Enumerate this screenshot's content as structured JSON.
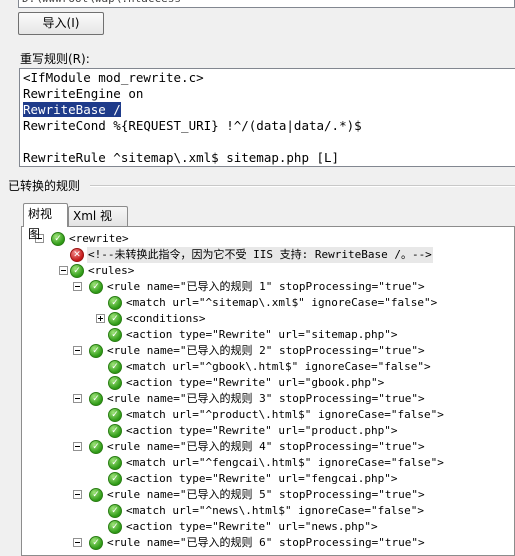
{
  "import_path": "D:\\wwwroot\\wap\\.htaccess",
  "import_button": "导入(I)",
  "rewrite_rules_label": "重写规则(R):",
  "editor_lines": [
    "<IfModule mod_rewrite.c>",
    "RewriteEngine on",
    "RewriteBase /",
    "RewriteCond %{REQUEST_URI} !^/(data|data/.*)$",
    "",
    "RewriteRule ^sitemap\\.xml$ sitemap.php [L]"
  ],
  "converted_rules_label": "已转换的规则",
  "tabs": [
    "树视图",
    "Xml 视图"
  ],
  "icons": {
    "ok": "check-circle-icon",
    "error": "error-x-icon"
  },
  "tree": [
    {
      "text": "<rewrite>",
      "level": 0,
      "toggle": "minus",
      "icon": "ok"
    },
    {
      "text": "<!--未转换此指令，因为它不受 IIS 支持: RewriteBase /。-->",
      "level": 1,
      "toggle": "",
      "icon": "err",
      "highlight": true
    },
    {
      "text": "<rules>",
      "level": 1,
      "toggle": "minus",
      "icon": "ok"
    },
    {
      "text": "<rule name=\"已导入的规则 1\" stopProcessing=\"true\">",
      "level": 2,
      "toggle": "minus",
      "icon": "ok"
    },
    {
      "text": "<match url=\"^sitemap\\.xml$\" ignoreCase=\"false\">",
      "level": 3,
      "toggle": "",
      "icon": "ok"
    },
    {
      "text": "<conditions>",
      "level": 3,
      "toggle": "plus",
      "icon": "ok"
    },
    {
      "text": "<action type=\"Rewrite\" url=\"sitemap.php\">",
      "level": 3,
      "toggle": "",
      "icon": "ok"
    },
    {
      "text": "<rule name=\"已导入的规则 2\" stopProcessing=\"true\">",
      "level": 2,
      "toggle": "minus",
      "icon": "ok"
    },
    {
      "text": "<match url=\"^gbook\\.html$\" ignoreCase=\"false\">",
      "level": 3,
      "toggle": "",
      "icon": "ok"
    },
    {
      "text": "<action type=\"Rewrite\" url=\"gbook.php\">",
      "level": 3,
      "toggle": "",
      "icon": "ok"
    },
    {
      "text": "<rule name=\"已导入的规则 3\" stopProcessing=\"true\">",
      "level": 2,
      "toggle": "minus",
      "icon": "ok"
    },
    {
      "text": "<match url=\"^product\\.html$\" ignoreCase=\"false\">",
      "level": 3,
      "toggle": "",
      "icon": "ok"
    },
    {
      "text": "<action type=\"Rewrite\" url=\"product.php\">",
      "level": 3,
      "toggle": "",
      "icon": "ok"
    },
    {
      "text": "<rule name=\"已导入的规则 4\" stopProcessing=\"true\">",
      "level": 2,
      "toggle": "minus",
      "icon": "ok"
    },
    {
      "text": "<match url=\"^fengcai\\.html$\" ignoreCase=\"false\">",
      "level": 3,
      "toggle": "",
      "icon": "ok"
    },
    {
      "text": "<action type=\"Rewrite\" url=\"fengcai.php\">",
      "level": 3,
      "toggle": "",
      "icon": "ok"
    },
    {
      "text": "<rule name=\"已导入的规则 5\" stopProcessing=\"true\">",
      "level": 2,
      "toggle": "minus",
      "icon": "ok"
    },
    {
      "text": "<match url=\"^news\\.html$\" ignoreCase=\"false\">",
      "level": 3,
      "toggle": "",
      "icon": "ok"
    },
    {
      "text": "<action type=\"Rewrite\" url=\"news.php\">",
      "level": 3,
      "toggle": "",
      "icon": "ok"
    },
    {
      "text": "<rule name=\"已导入的规则 6\" stopProcessing=\"true\">",
      "level": 2,
      "toggle": "minus",
      "icon": "ok"
    }
  ]
}
